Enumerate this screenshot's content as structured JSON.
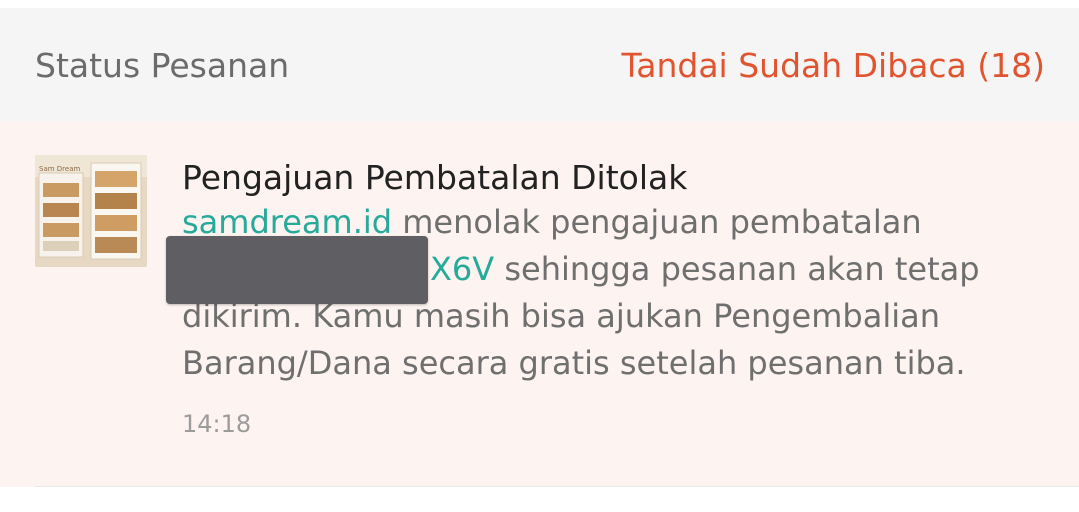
{
  "header": {
    "title": "Status Pesanan",
    "mark_read_label": "Tandai Sudah Dibaca (18)",
    "accent_color": "#e0552f"
  },
  "notification": {
    "title": "Pengajuan Pembatalan Ditolak",
    "shop_name": "samdream.id",
    "text_1": " menolak pengajuan pembatalan",
    "order_id_suffix": "X6V",
    "text_2": " sehingga pesanan akan tetap dikirim. Kamu masih bisa ajukan Pengembalian Barang/Dana secara gratis setelah pesanan tiba.",
    "time": "14:18",
    "thumbnail_icon": "product-shelf-image",
    "link_color": "#26aa99"
  }
}
